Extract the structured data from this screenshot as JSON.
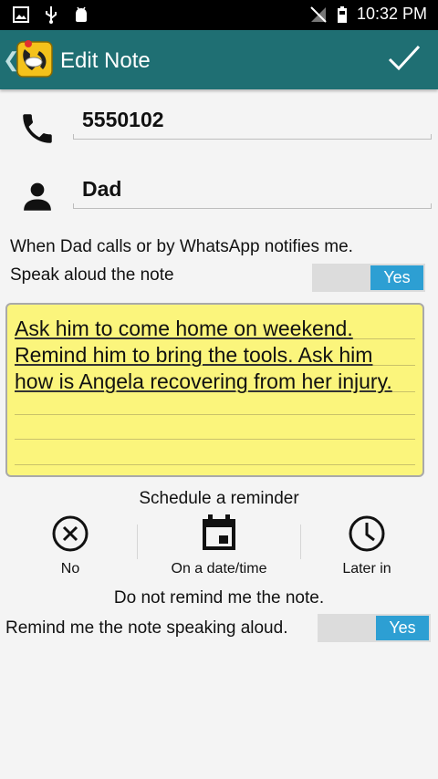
{
  "status_bar": {
    "time": "10:32 PM"
  },
  "app_bar": {
    "title": "Edit Note",
    "confirm_icon": "checkmark-icon"
  },
  "contact": {
    "phone": "5550102",
    "name": "Dad"
  },
  "trigger_text": "When Dad calls or by WhatsApp notifies me.",
  "speak_aloud": {
    "label": "Speak aloud the note",
    "toggle": "Yes"
  },
  "note": {
    "text": "Ask him to come home on weekend.\nRemind him to bring the tools. Ask him\nhow is Angela recovering from her injury."
  },
  "reminder": {
    "heading": "Schedule a reminder",
    "options": [
      {
        "label": "No",
        "icon": "close-circle-icon"
      },
      {
        "label": "On a date/time",
        "icon": "calendar-icon"
      },
      {
        "label": "Later in",
        "icon": "clock-icon"
      }
    ],
    "status": "Do not remind me the note.",
    "speak_label": "Remind me the note speaking aloud.",
    "speak_toggle": "Yes"
  },
  "colors": {
    "app_bar": "#1f6f73",
    "toggle_on": "#2d9fd3",
    "note_bg": "#fbf57c"
  }
}
